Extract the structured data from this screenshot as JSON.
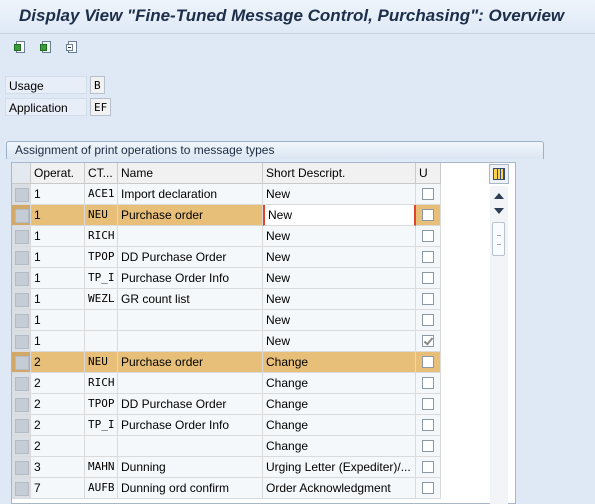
{
  "window": {
    "title": "Display View \"Fine-Tuned Message Control, Purchasing\": Overview"
  },
  "toolbar": {
    "icons": [
      "document-icon",
      "next-entry-icon",
      "other-entry-icon"
    ]
  },
  "fields": {
    "usage": {
      "label": "Usage",
      "value": "B"
    },
    "application": {
      "label": "Application",
      "value": "EF"
    }
  },
  "group": {
    "title": "Assignment of print operations to message types"
  },
  "table": {
    "headers": {
      "operat": "Operat.",
      "ct": "CT...",
      "name": "Name",
      "short": "Short Descript.",
      "u": "U"
    },
    "rows": [
      {
        "op": "1",
        "ct": "ACE1",
        "name": "Import declaration",
        "short": "New",
        "u": false,
        "highlight": false,
        "editing": false
      },
      {
        "op": "1",
        "ct": "NEU",
        "name": "Purchase order",
        "short": "New",
        "u": false,
        "highlight": true,
        "editing": true
      },
      {
        "op": "1",
        "ct": "RICH",
        "name": "",
        "short": "New",
        "u": false,
        "highlight": false,
        "editing": false
      },
      {
        "op": "1",
        "ct": "TPOP",
        "name": "DD Purchase Order",
        "short": "New",
        "u": false,
        "highlight": false,
        "editing": false
      },
      {
        "op": "1",
        "ct": "TP_I",
        "name": "Purchase Order Info",
        "short": "New",
        "u": false,
        "highlight": false,
        "editing": false
      },
      {
        "op": "1",
        "ct": "WEZL",
        "name": "GR count list",
        "short": "New",
        "u": false,
        "highlight": false,
        "editing": false
      },
      {
        "op": "1",
        "ct": "",
        "name": "",
        "short": "New",
        "u": false,
        "highlight": false,
        "editing": false
      },
      {
        "op": "1",
        "ct": "",
        "name": "",
        "short": "New",
        "u": true,
        "highlight": false,
        "editing": false
      },
      {
        "op": "2",
        "ct": "NEU",
        "name": "Purchase order",
        "short": "Change",
        "u": false,
        "highlight": true,
        "editing": false
      },
      {
        "op": "2",
        "ct": "RICH",
        "name": "",
        "short": "Change",
        "u": false,
        "highlight": false,
        "editing": false
      },
      {
        "op": "2",
        "ct": "TPOP",
        "name": "DD Purchase Order",
        "short": "Change",
        "u": false,
        "highlight": false,
        "editing": false
      },
      {
        "op": "2",
        "ct": "TP_I",
        "name": "Purchase Order Info",
        "short": "Change",
        "u": false,
        "highlight": false,
        "editing": false
      },
      {
        "op": "2",
        "ct": "",
        "name": "",
        "short": "Change",
        "u": false,
        "highlight": false,
        "editing": false
      },
      {
        "op": "3",
        "ct": "MAHN",
        "name": "Dunning",
        "short": "Urging Letter (Expediter)/...",
        "u": false,
        "highlight": false,
        "editing": false
      },
      {
        "op": "7",
        "ct": "AUFB",
        "name": "Dunning ord confirm",
        "short": "Order Acknowledgment",
        "u": false,
        "highlight": false,
        "editing": false
      }
    ]
  },
  "controls": {
    "column_settings": "column-settings-icon",
    "scroll_up": "scroll-up-icon",
    "scroll_down": "scroll-down-icon"
  }
}
